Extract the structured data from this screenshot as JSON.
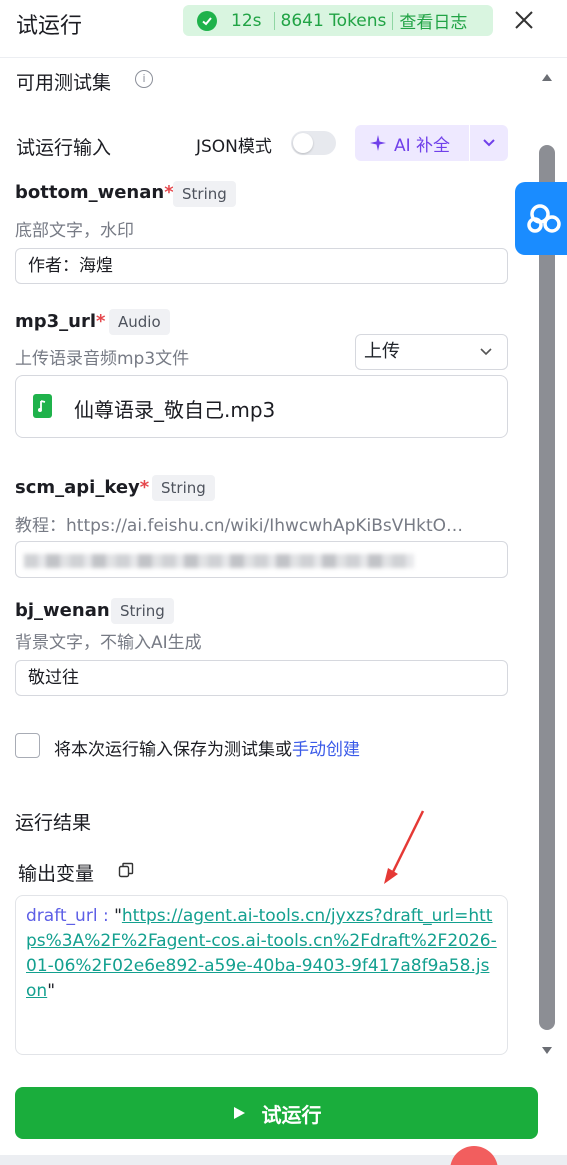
{
  "header": {
    "title": "试运行",
    "status_time": "12s",
    "status_tokens": "8641 Tokens",
    "view_log": "查看日志"
  },
  "test_sets": {
    "title": "可用测试集"
  },
  "inputs": {
    "title": "试运行输入",
    "json_mode_label": "JSON模式",
    "ai_fill_label": "AI 补全",
    "fields": [
      {
        "name": "bottom_wenan",
        "required": "*",
        "type": "String",
        "desc": "底部文字，水印",
        "value": "作者：海煌"
      },
      {
        "name": "mp3_url",
        "required": "*",
        "type": "Audio",
        "desc": "上传语录音频mp3文件",
        "select_value": "上传",
        "file_name": "仙尊语录_敬自己.mp3"
      },
      {
        "name": "scm_api_key",
        "required": "*",
        "type": "String",
        "desc": "教程：https://ai.feishu.cn/wiki/IhwcwhApKiBsVHktO…"
      },
      {
        "name": "bj_wenan",
        "required": "",
        "type": "String",
        "desc": "背景文字，不输入AI生成",
        "value": "敬过往"
      }
    ],
    "save_text": "将本次运行输入保存为测试集或",
    "save_link": "手动创建"
  },
  "result": {
    "title": "运行结果",
    "output_title": "输出变量",
    "output_key": "draft_url : ",
    "quote_open": "\"",
    "output_value": "https://agent.ai-tools.cn/jyxzs?draft_url=https%3A%2F%2Fagent-cos.ai-tools.cn%2Fdraft%2F2026-01-06%2F02e6e892-a59e-40ba-9403-9f417a8f9a58.json",
    "quote_close": "\""
  },
  "run_button": {
    "label": "试运行"
  },
  "colors": {
    "accent_green": "#1aad3c",
    "status_bg": "#d9f5e0",
    "ai_purple": "#7040ea",
    "link_teal": "#13a08f",
    "link_blue": "#3a5ae8",
    "required_red": "#e5484d"
  }
}
